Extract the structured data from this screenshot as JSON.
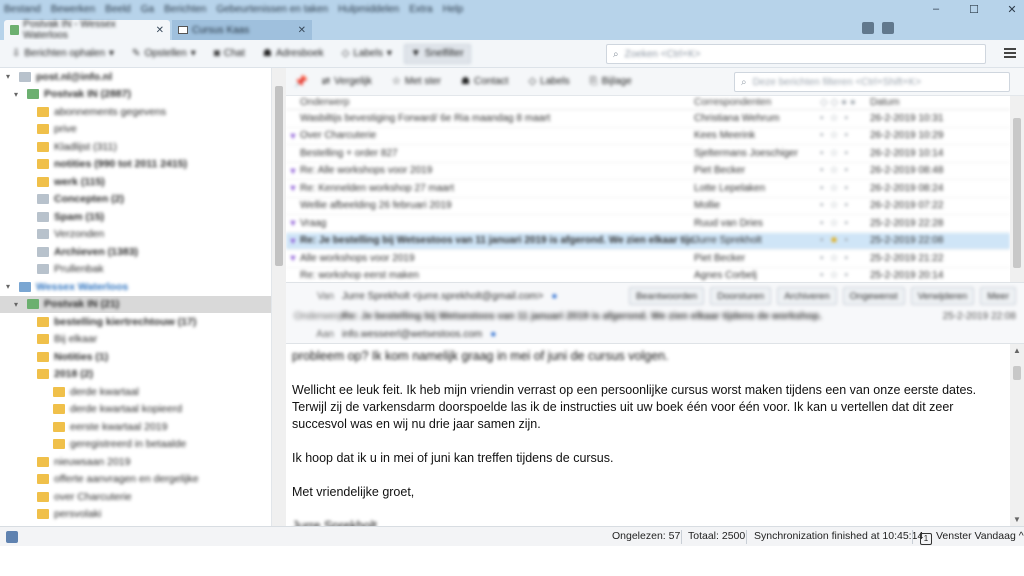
{
  "window": {
    "menus": [
      "Bestand",
      "Bewerken",
      "Beeld",
      "Ga",
      "Berichten",
      "Gebeurtenissen en taken",
      "Hulpmiddelen",
      "Extra",
      "Help"
    ],
    "tabs": [
      {
        "label": "Postvak IN - Wessex Waterloos",
        "active": true
      },
      {
        "label": "Cursus Kaas",
        "active": false
      }
    ]
  },
  "toolbar": {
    "get_messages": "Berichten ophalen",
    "compose": "Opstellen",
    "chat": "Chat",
    "address_book": "Adresboek",
    "tags": "Labels",
    "quick_filter": "Snelfilter",
    "search_placeholder": "Zoeken <Ctrl+K>"
  },
  "folders": [
    {
      "label": "post.nl@info.nl",
      "type": "account",
      "bold": true
    },
    {
      "label": "Postvak IN (2887)",
      "type": "inbox",
      "bold": true
    },
    {
      "label": "abonnements gegevens",
      "type": "folder"
    },
    {
      "label": "prive",
      "type": "folder"
    },
    {
      "label": "Kladlijst (311)",
      "type": "folder"
    },
    {
      "label": "notities (990 tot 2011 2415)",
      "type": "folder",
      "bold": true
    },
    {
      "label": "werk (115)",
      "type": "folder",
      "bold": true
    },
    {
      "label": "Concepten (2)",
      "type": "drafts",
      "bold": true
    },
    {
      "label": "Spam (15)",
      "type": "spam",
      "bold": true
    },
    {
      "label": "Verzonden",
      "type": "sent"
    },
    {
      "label": "Archieven (1383)",
      "type": "archive",
      "bold": true
    },
    {
      "label": "Prullenbak",
      "type": "trash"
    },
    {
      "label": "Wessex Waterloos",
      "type": "account-blue"
    },
    {
      "label": "Postvak IN (21)",
      "type": "inbox",
      "bold": true,
      "selected": true
    },
    {
      "label": "bestelling kiertrechtouw (17)",
      "type": "folder",
      "bold": true
    },
    {
      "label": "Bij elkaar",
      "type": "folder"
    },
    {
      "label": "Notities (1)",
      "type": "folder",
      "bold": true
    },
    {
      "label": "2018 (2)",
      "type": "folder",
      "bold": true
    },
    {
      "label": "derde kwartaal",
      "type": "folder"
    },
    {
      "label": "derde kwartaal kopieerd",
      "type": "folder"
    },
    {
      "label": "eerste kwartaal 2019",
      "type": "folder"
    },
    {
      "label": "geregistreerd in betaalde",
      "type": "folder"
    },
    {
      "label": "nieuwsaan 2019",
      "type": "folder"
    },
    {
      "label": "offerte aanvragen en dergelijke",
      "type": "folder"
    },
    {
      "label": "over Charcuterie",
      "type": "folder"
    },
    {
      "label": "persvolaki",
      "type": "folder"
    }
  ],
  "message_toolbar": {
    "actions": [
      "Vergelijk",
      "Met ster",
      "Contact",
      "Labels",
      "Bijlage"
    ],
    "filter_placeholder": "Deze berichten filteren <Ctrl+Shift+K>"
  },
  "thread_list": {
    "columns": {
      "subject": "Onderwerp",
      "from": "Correspondenten",
      "date": "Datum"
    },
    "rows": [
      {
        "subject": "Wasbiltijs bevestiging Forward/ 6e Ria maandag 8 maart",
        "from": "Christiana Wehrum",
        "date": "26-2-2019 10:31",
        "mark": ""
      },
      {
        "subject": "Over Charcuterie",
        "from": "Kees Meerink",
        "date": "26-2-2019 10:29",
        "mark": "purple"
      },
      {
        "subject": "Bestelling + order 827",
        "from": "Sjeltermans Joeschiger",
        "date": "26-2-2019 10:14",
        "mark": ""
      },
      {
        "subject": "Re: Alle workshops voor 2019",
        "from": "Piet Becker",
        "date": "26-2-2019 08:48",
        "mark": "purple"
      },
      {
        "subject": "Re: Kennelden workshop 27 maart",
        "from": "Lotte Lepelaken",
        "date": "26-2-2019 08:24",
        "mark": "purple"
      },
      {
        "subject": "Wellie afbeelding 26 februari 2019",
        "from": "Mollie",
        "date": "26-2-2019 07:22",
        "mark": ""
      },
      {
        "subject": "Vraag",
        "from": "Ruud van Dries",
        "date": "25-2-2019 22:28",
        "mark": "purple"
      },
      {
        "subject": "Re: Je bestelling bij Wetsestoos van 11 januari 2019 is afgerond. We zien elkaar tijdens ...",
        "from": "Jurre Sprekholt",
        "date": "25-2-2019 22:08",
        "mark": "purple",
        "selected": true
      },
      {
        "subject": "Alle workshops voor 2019",
        "from": "Piet Becker",
        "date": "25-2-2019 21:22",
        "mark": "purple"
      },
      {
        "subject": "Re: workshop eerst maken",
        "from": "Agnes Corbelj",
        "date": "25-2-2019 20:14",
        "mark": ""
      }
    ]
  },
  "message_header": {
    "from_label": "Van",
    "from_value": "Jurre Sprekholt <jurre.sprekholt@gmail.com>",
    "subject_label": "Onderwerp",
    "subject_value": "Re: Je bestelling bij Wetsestoos van 11 januari 2019 is afgerond. We zien elkaar tijdens de workshop.",
    "to_label": "Aan",
    "to_value": "info.wesseerl@wetsestoos.com",
    "date": "25-2-2019 22:08",
    "actions": [
      "Beantwoorden",
      "Doorsturen",
      "Archiveren",
      "Ongewenst",
      "Verwijderen",
      "Meer"
    ]
  },
  "message_body": {
    "partial_top_line": "probleem op? Ik kom namelijk graag in mei of juni de cursus volgen.",
    "paragraphs": [
      "Wellicht ee leuk feit. Ik heb mijn vriendin verrast op een persoonlijke cursus worst maken tijdens een van onze eerste dates. Terwijl zij de varkensdarm doorspoelde las ik de instructies uit uw boek één voor één voor. Ik kan u vertellen dat dit zeer succesvol was en wij nu drie jaar samen zijn.",
      "Ik hoop dat ik u in mei of juni kan treffen tijdens de cursus.",
      "Met vriendelijke groet,"
    ],
    "partial_bottom_line": "Jurre Sprekholt"
  },
  "statusbar": {
    "unread": "Ongelezen: 57",
    "total": "Totaal: 2500",
    "sync": "Synchronization finished at 10:45:14",
    "today_pane": "Venster Vandaag"
  },
  "colors": {
    "titlebar": "#b7d3ea",
    "selected_row": "#cfe5f7",
    "tag_purple": "#8b5ad6",
    "folder_yellow": "#f0c04a"
  }
}
